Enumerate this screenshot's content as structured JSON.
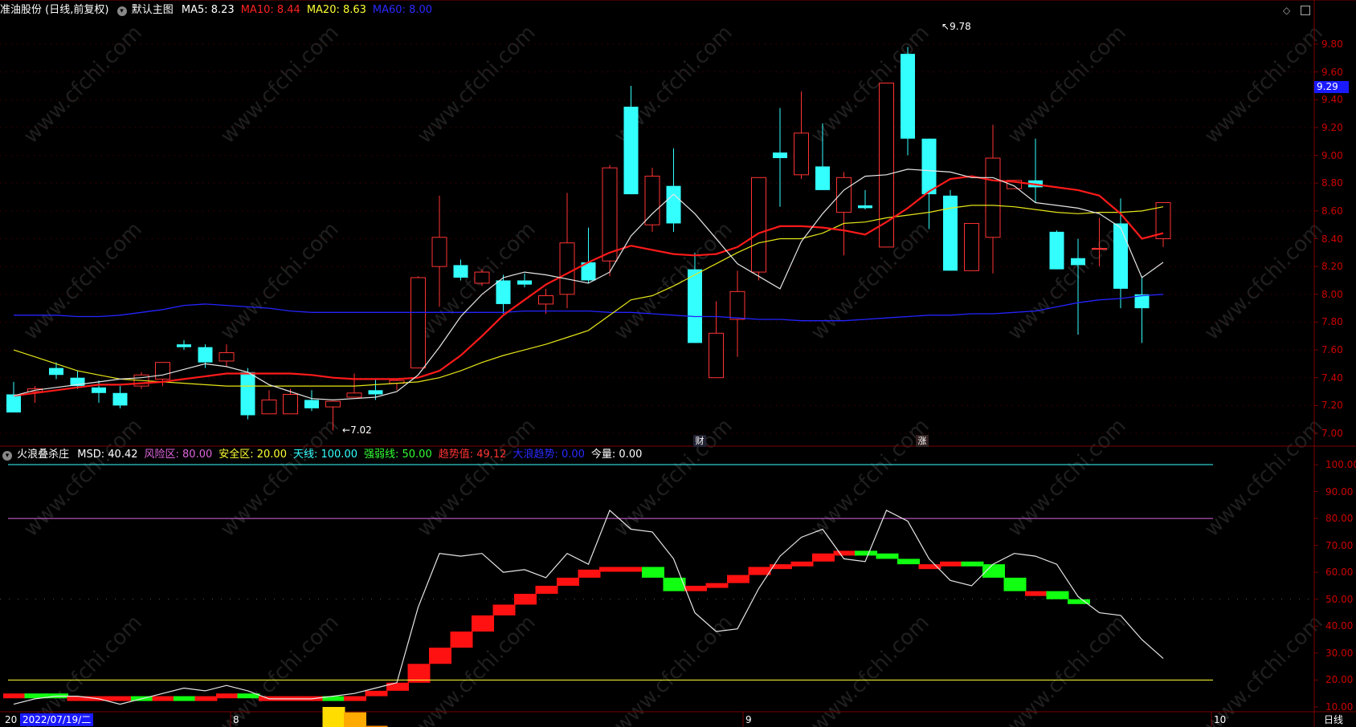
{
  "main_panel": {
    "stock_title": "准油股份 (日线,前复权)",
    "chart_mode": "默认主图",
    "indicators": [
      {
        "label": "MA5: 8.23",
        "color": "#ffffff"
      },
      {
        "label": "MA10: 8.44",
        "color": "#ff2222"
      },
      {
        "label": "MA20: 8.63",
        "color": "#ffff33"
      },
      {
        "label": "MA60: 8.00",
        "color": "#2a2aff"
      }
    ],
    "price_ticks": [
      "9.80",
      "9.60",
      "9.40",
      "9.20",
      "9.00",
      "8.80",
      "8.60",
      "8.40",
      "8.20",
      "8.00",
      "7.80",
      "7.60",
      "7.40",
      "7.20",
      "7.00"
    ],
    "current_price_badge": "9.29",
    "high_annotation": "9.78",
    "low_annotation": "7.02",
    "event_markers": [
      "财",
      "涨"
    ]
  },
  "sub_panel": {
    "indicator_name": "火浪叠杀庄",
    "params": [
      {
        "label": "MSD: 40.42",
        "color": "#ffffff"
      },
      {
        "label": "风险区: 80.00",
        "color": "#dd66dd"
      },
      {
        "label": "安全区: 20.00",
        "color": "#ffff33"
      },
      {
        "label": "天线: 100.00",
        "color": "#33ffff"
      },
      {
        "label": "强弱线: 50.00",
        "color": "#33ff33"
      },
      {
        "label": "趋势值: 49.12",
        "color": "#ff3333"
      },
      {
        "label": "大浪趋势: 0.00",
        "color": "#2a2aff"
      },
      {
        "label": "今量: 0.00",
        "color": "#ffffff"
      }
    ],
    "value_ticks": [
      "100.00",
      "90.00",
      "80.00",
      "70.00",
      "60.00",
      "50.00",
      "40.00",
      "30.00",
      "20.00",
      "10.00"
    ]
  },
  "bottom_bar": {
    "year_prefix": "20",
    "cursor_date": "2022/07/19/二",
    "month_labels": [
      "8",
      "9",
      "10"
    ],
    "period": "日线"
  },
  "watermark": "www.cfchi.com",
  "colors": {
    "up": "#ff3333",
    "down": "#33ffff",
    "ma5": "#e6e6e6",
    "ma10": "#ff1a1a",
    "ma20": "#e6e619",
    "ma60": "#2424ff",
    "badge_bg": "#1a1aff"
  },
  "chart_data": [
    {
      "type": "candlestick",
      "title": "准油股份 (日线,前复权)",
      "ylim": [
        7.0,
        9.8
      ],
      "candles": [
        [
          7.28,
          7.37,
          7.15,
          7.15
        ],
        [
          7.3,
          7.34,
          7.22,
          7.32
        ],
        [
          7.47,
          7.51,
          7.39,
          7.42
        ],
        [
          7.4,
          7.45,
          7.32,
          7.34
        ],
        [
          7.33,
          7.38,
          7.22,
          7.29
        ],
        [
          7.29,
          7.34,
          7.18,
          7.2
        ],
        [
          7.34,
          7.44,
          7.32,
          7.42
        ],
        [
          7.39,
          7.51,
          7.34,
          7.51
        ],
        [
          7.64,
          7.67,
          7.6,
          7.62
        ],
        [
          7.62,
          7.64,
          7.47,
          7.51
        ],
        [
          7.52,
          7.64,
          7.48,
          7.58
        ],
        [
          7.44,
          7.47,
          7.1,
          7.13
        ],
        [
          7.14,
          7.31,
          7.14,
          7.24
        ],
        [
          7.14,
          7.32,
          7.14,
          7.28
        ],
        [
          7.24,
          7.31,
          7.16,
          7.18
        ],
        [
          7.19,
          7.23,
          7.02,
          7.23
        ],
        [
          7.26,
          7.43,
          7.26,
          7.29
        ],
        [
          7.31,
          7.39,
          7.24,
          7.28
        ],
        [
          7.36,
          7.39,
          7.31,
          7.38
        ],
        [
          7.47,
          8.13,
          7.47,
          8.12
        ],
        [
          8.2,
          8.71,
          7.91,
          8.41
        ],
        [
          8.21,
          8.25,
          8.1,
          8.12
        ],
        [
          8.08,
          8.18,
          8.06,
          8.16
        ],
        [
          8.1,
          8.14,
          7.86,
          7.93
        ],
        [
          8.1,
          8.15,
          8.05,
          8.07
        ],
        [
          7.93,
          8.04,
          7.86,
          7.99
        ],
        [
          8.0,
          8.73,
          7.9,
          8.37
        ],
        [
          8.23,
          8.48,
          8.08,
          8.1
        ],
        [
          8.24,
          8.93,
          8.13,
          8.91
        ],
        [
          9.35,
          9.5,
          8.72,
          8.72
        ],
        [
          8.5,
          8.91,
          8.45,
          8.85
        ],
        [
          8.78,
          9.05,
          8.45,
          8.51
        ],
        [
          8.18,
          8.3,
          7.65,
          7.65
        ],
        [
          7.4,
          7.95,
          7.4,
          7.72
        ],
        [
          7.82,
          8.17,
          7.55,
          8.02
        ],
        [
          8.16,
          8.84,
          8.1,
          8.84
        ],
        [
          9.02,
          9.34,
          8.63,
          8.98
        ],
        [
          8.86,
          9.46,
          8.83,
          9.16
        ],
        [
          8.92,
          9.23,
          8.75,
          8.75
        ],
        [
          8.59,
          8.88,
          8.28,
          8.84
        ],
        [
          8.64,
          8.75,
          8.61,
          8.62
        ],
        [
          8.34,
          9.0,
          8.34,
          9.52
        ],
        [
          9.73,
          9.78,
          9.0,
          9.12
        ],
        [
          9.12,
          9.12,
          8.47,
          8.72
        ],
        [
          8.71,
          8.75,
          8.17,
          8.17
        ],
        [
          8.17,
          8.51,
          8.17,
          8.51
        ],
        [
          8.41,
          9.22,
          8.15,
          8.98
        ],
        [
          8.76,
          8.82,
          8.76,
          8.82
        ],
        [
          8.82,
          9.12,
          8.66,
          8.77
        ],
        [
          8.45,
          8.46,
          8.18,
          8.18
        ],
        [
          8.26,
          8.4,
          7.71,
          8.21
        ],
        [
          8.33,
          8.55,
          8.2,
          8.33
        ],
        [
          8.51,
          8.69,
          7.9,
          8.04
        ],
        [
          8.0,
          8.13,
          7.65,
          7.9
        ],
        [
          8.4,
          8.66,
          8.34,
          8.66
        ]
      ],
      "ma5": [
        7.27,
        7.31,
        7.33,
        7.35,
        7.37,
        7.39,
        7.4,
        7.42,
        7.46,
        7.5,
        7.48,
        7.44,
        7.35,
        7.3,
        7.25,
        7.24,
        7.25,
        7.26,
        7.3,
        7.42,
        7.62,
        7.84,
        8.0,
        8.12,
        8.16,
        8.14,
        8.11,
        8.08,
        8.16,
        8.42,
        8.58,
        8.72,
        8.58,
        8.4,
        8.22,
        8.13,
        8.04,
        8.38,
        8.58,
        8.75,
        8.85,
        8.86,
        8.9,
        8.89,
        8.88,
        8.84,
        8.84,
        8.78,
        8.66,
        8.64,
        8.62,
        8.58,
        8.48,
        8.12,
        8.23
      ],
      "ma10": [
        7.27,
        7.29,
        7.31,
        7.33,
        7.35,
        7.35,
        7.36,
        7.37,
        7.39,
        7.41,
        7.43,
        7.43,
        7.43,
        7.43,
        7.42,
        7.4,
        7.39,
        7.39,
        7.39,
        7.4,
        7.45,
        7.56,
        7.7,
        7.85,
        7.96,
        8.07,
        8.15,
        8.23,
        8.3,
        8.35,
        8.32,
        8.29,
        8.28,
        8.29,
        8.34,
        8.44,
        8.49,
        8.49,
        8.48,
        8.46,
        8.43,
        8.52,
        8.62,
        8.74,
        8.83,
        8.85,
        8.82,
        8.81,
        8.79,
        8.77,
        8.75,
        8.71,
        8.58,
        8.4,
        8.44
      ],
      "ma20": [
        7.6,
        7.55,
        7.5,
        7.45,
        7.42,
        7.39,
        7.38,
        7.37,
        7.36,
        7.35,
        7.34,
        7.34,
        7.34,
        7.34,
        7.34,
        7.34,
        7.34,
        7.35,
        7.36,
        7.37,
        7.4,
        7.45,
        7.51,
        7.56,
        7.6,
        7.64,
        7.69,
        7.74,
        7.85,
        7.96,
        7.99,
        8.06,
        8.14,
        8.22,
        8.3,
        8.37,
        8.4,
        8.4,
        8.44,
        8.51,
        8.52,
        8.55,
        8.57,
        8.59,
        8.62,
        8.64,
        8.64,
        8.63,
        8.61,
        8.59,
        8.58,
        8.59,
        8.59,
        8.6,
        8.63
      ],
      "ma60": [
        7.85,
        7.85,
        7.85,
        7.84,
        7.84,
        7.85,
        7.87,
        7.89,
        7.92,
        7.93,
        7.92,
        7.91,
        7.9,
        7.88,
        7.87,
        7.87,
        7.87,
        7.87,
        7.87,
        7.87,
        7.87,
        7.87,
        7.87,
        7.87,
        7.88,
        7.88,
        7.88,
        7.88,
        7.87,
        7.87,
        7.86,
        7.85,
        7.84,
        7.84,
        7.83,
        7.82,
        7.82,
        7.81,
        7.81,
        7.81,
        7.82,
        7.83,
        7.84,
        7.85,
        7.85,
        7.86,
        7.86,
        7.87,
        7.88,
        7.91,
        7.94,
        7.96,
        7.97,
        7.99,
        8.0
      ]
    },
    {
      "type": "area",
      "title": "火浪叠杀庄",
      "ylim": [
        0,
        105
      ],
      "x": [
        1,
        2,
        3,
        4,
        5,
        6,
        7,
        8,
        9,
        10,
        11,
        12,
        13,
        14,
        15,
        16,
        17,
        18,
        19,
        20,
        21,
        22,
        23,
        24,
        25,
        26,
        27,
        28,
        29,
        30,
        31,
        32,
        33,
        34,
        35,
        36,
        37,
        38,
        39,
        40,
        41,
        42,
        43,
        44,
        45,
        46,
        47,
        48,
        49,
        50,
        51,
        52,
        53,
        54,
        55
      ],
      "msd": [
        11,
        13,
        14,
        14,
        13,
        11,
        13,
        15,
        17,
        16,
        18,
        16,
        13,
        13,
        13,
        14,
        15,
        17,
        19,
        47,
        67,
        66,
        67,
        60,
        61,
        58,
        67,
        63,
        83,
        76,
        75,
        65,
        45,
        38,
        39,
        54,
        66,
        73,
        76,
        65,
        64,
        83,
        79,
        65,
        57,
        55,
        63,
        67,
        66,
        63,
        51,
        45,
        44,
        35,
        28
      ],
      "trend_blocks": [
        [
          15,
          15
        ],
        [
          15,
          14
        ],
        [
          15,
          14
        ],
        [
          14,
          14
        ],
        [
          14,
          14
        ],
        [
          14,
          14
        ],
        [
          14,
          13
        ],
        [
          13,
          14
        ],
        [
          14,
          13
        ],
        [
          13,
          14
        ],
        [
          14,
          15
        ],
        [
          15,
          14
        ],
        [
          14,
          14
        ],
        [
          14,
          14
        ],
        [
          14,
          14
        ],
        [
          14,
          13
        ],
        [
          13,
          14
        ],
        [
          14,
          16
        ],
        [
          16,
          19
        ],
        [
          19,
          26
        ],
        [
          26,
          32
        ],
        [
          32,
          38
        ],
        [
          38,
          44
        ],
        [
          44,
          48
        ],
        [
          48,
          52
        ],
        [
          52,
          55
        ],
        [
          55,
          58
        ],
        [
          58,
          61
        ],
        [
          61,
          62
        ],
        [
          62,
          62
        ],
        [
          62,
          58
        ],
        [
          58,
          53
        ],
        [
          53,
          55
        ],
        [
          55,
          56
        ],
        [
          56,
          59
        ],
        [
          59,
          62
        ],
        [
          62,
          63
        ],
        [
          63,
          64
        ],
        [
          64,
          67
        ],
        [
          67,
          68
        ],
        [
          68,
          67
        ],
        [
          67,
          65
        ],
        [
          65,
          63
        ],
        [
          63,
          63
        ],
        [
          63,
          64
        ],
        [
          64,
          63
        ],
        [
          63,
          58
        ],
        [
          58,
          53
        ],
        [
          53,
          53
        ],
        [
          53,
          50
        ],
        [
          50,
          49
        ]
      ],
      "volume_bars": [
        [
          0,
          2,
          "#ffcc00"
        ],
        [
          1,
          2,
          "#ffcc00"
        ],
        [
          15,
          10,
          "#ffdd00"
        ],
        [
          16,
          8,
          "#ffaa00"
        ],
        [
          17,
          3,
          "#ff8800"
        ],
        [
          18,
          2,
          "#ffaa00"
        ],
        [
          19,
          1,
          "#ffcc00"
        ]
      ],
      "reference_lines": [
        {
          "name": "天线",
          "value": 100,
          "color": "#33ffff"
        },
        {
          "name": "风险区",
          "value": 80,
          "color": "#dd66dd"
        },
        {
          "name": "强弱线",
          "value": 50,
          "color": "#33ff33"
        },
        {
          "name": "安全区",
          "value": 20,
          "color": "#ffff33"
        }
      ]
    }
  ]
}
